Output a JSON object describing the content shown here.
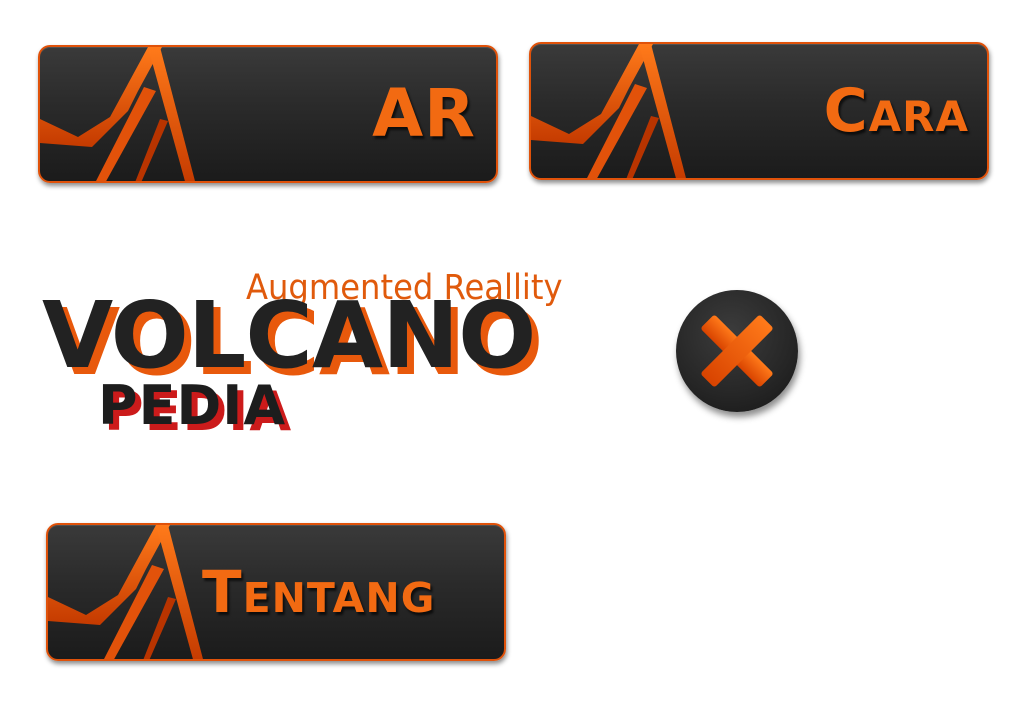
{
  "menu": {
    "ar_label": "AR",
    "cara_label": "Cara",
    "tentang_label": "Tentang"
  },
  "logo": {
    "subtitle": "Augmented Reallity",
    "title": "VOLCANO",
    "title_sub": "PEDIA"
  },
  "colors": {
    "accent": "#f26a12",
    "button_bg": "#262626",
    "shadow_red": "#cc1b1b"
  },
  "icons": {
    "menu_icon": "volcano-icon",
    "close_icon": "close-icon"
  }
}
